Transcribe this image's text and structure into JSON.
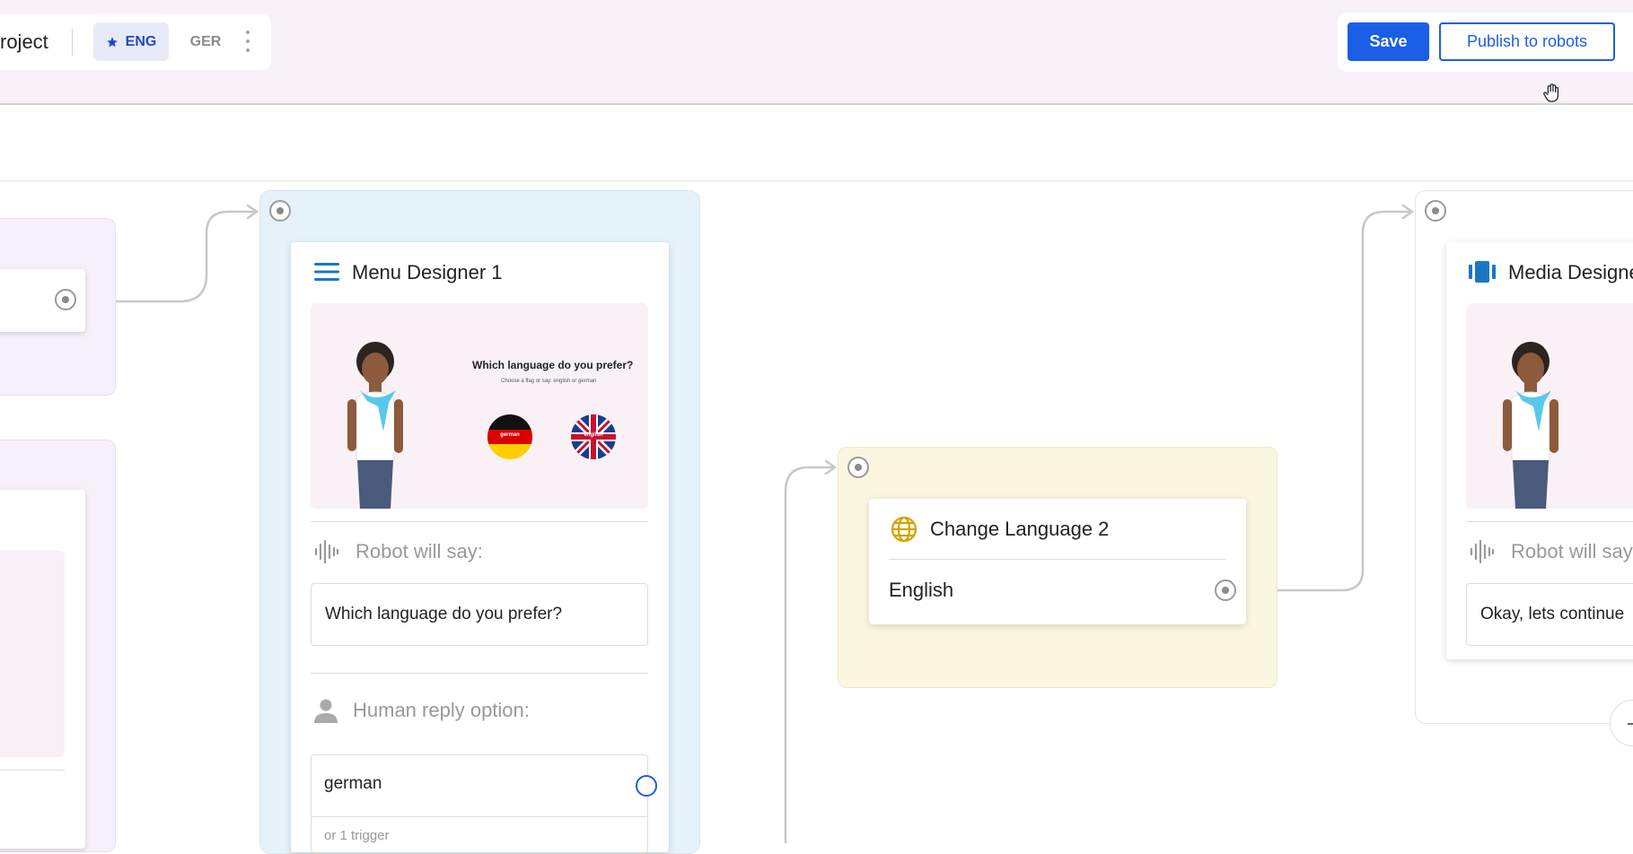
{
  "header": {
    "project_title": "roject",
    "languages": [
      {
        "code": "ENG",
        "active": true
      },
      {
        "code": "GER",
        "active": false
      }
    ],
    "save_label": "Save",
    "publish_label": "Publish to robots"
  },
  "nodes": {
    "menu_designer": {
      "title": "Menu Designer 1",
      "preview": {
        "question": "Which language do you prefer?",
        "subtitle": "Choose a flag or say: english or german",
        "flags": [
          {
            "label": "german"
          },
          {
            "label": "english"
          }
        ]
      },
      "robot_say_label": "Robot will say:",
      "robot_say_text": "Which language do you prefer?",
      "human_reply_label": "Human reply option:",
      "reply_option": "german",
      "reply_trigger": "or 1 trigger"
    },
    "change_language": {
      "title": "Change Language 2",
      "option": "English"
    },
    "media_designer": {
      "title": "Media Designe",
      "robot_say_label": "Robot will say",
      "robot_say_text": "Okay, lets continue"
    }
  },
  "colors": {
    "primary": "#1b5ee6",
    "menu_group_bg": "#e6f2f9",
    "language_group_bg": "#fbf6e0",
    "left_group_bg": "#f5f0fa",
    "globe_icon": "#d4a300",
    "menu_icon": "#1a78c2"
  },
  "icons": [
    "star-icon",
    "more-vert-icon",
    "hand-cursor-icon",
    "hamburger-menu-icon",
    "waveform-icon",
    "person-icon",
    "globe-icon",
    "media-carousel-icon",
    "plus-icon"
  ]
}
